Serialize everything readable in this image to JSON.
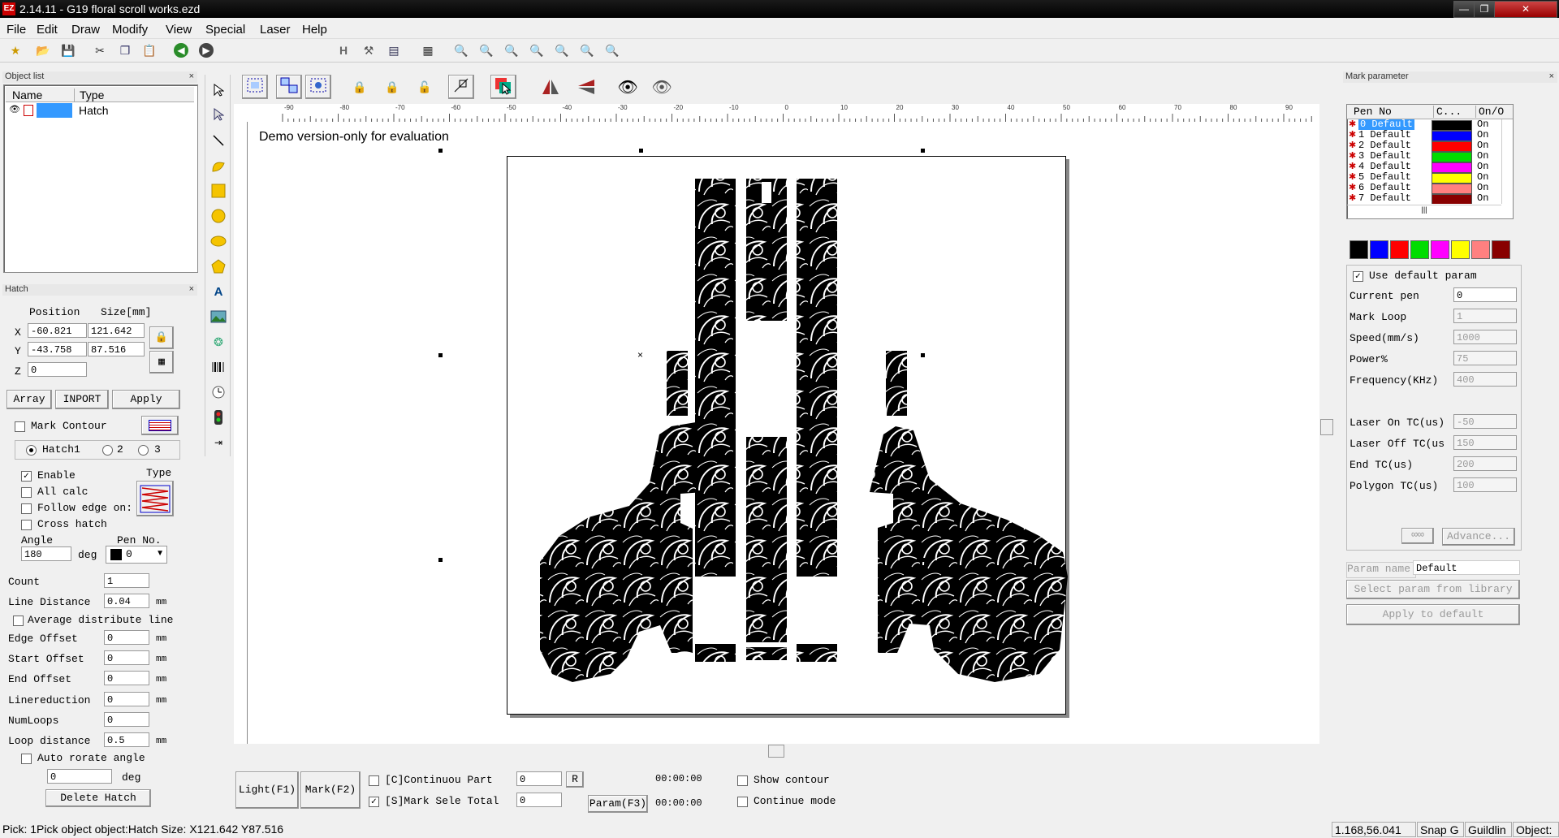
{
  "window": {
    "title": "2.14.11 - G19 floral scroll works.ezd",
    "app_icon": "EZ"
  },
  "menu": [
    "File",
    "Edit",
    "Draw",
    "Modify",
    "View",
    "Special",
    "Laser",
    "Help"
  ],
  "object_list": {
    "header": "Object list",
    "columns": [
      "Name",
      "Type"
    ],
    "rows": [
      {
        "name": "",
        "type": "Hatch"
      }
    ]
  },
  "hatch_panel": {
    "header": "Hatch",
    "position_label": "Position",
    "size_label": "Size[mm]",
    "x_label": "X",
    "y_label": "Y",
    "z_label": "Z",
    "pos_x": "-60.821",
    "pos_y": "-43.758",
    "pos_z": "0",
    "size_x": "121.642",
    "size_y": "87.516",
    "array_btn": "Array",
    "inport_btn": "INPORT",
    "apply_btn": "Apply",
    "mark_contour": "Mark Contour",
    "hatch1": "Hatch1",
    "hatch2": "2",
    "hatch3": "3",
    "enable": "Enable",
    "type_label": "Type",
    "all_calc": "All calc",
    "follow_edge": "Follow edge on:",
    "cross_hatch": "Cross hatch",
    "angle_label": "Angle",
    "angle_value": "180",
    "deg1": "deg",
    "pen_no_label": "Pen No.",
    "pen_no_value": "0",
    "count_label": "Count",
    "count_value": "1",
    "line_distance_label": "Line Distance",
    "line_distance_value": "0.04",
    "avg_distribute": "Average distribute line",
    "edge_offset_label": "Edge Offset",
    "edge_offset_value": "0",
    "start_offset_label": "Start Offset",
    "start_offset_value": "0",
    "end_offset_label": "End Offset",
    "end_offset_value": "0",
    "linereduction_label": "Linereduction",
    "linereduction_value": "0",
    "numloops_label": "NumLoops",
    "numloops_value": "0",
    "loop_distance_label": "Loop distance",
    "loop_distance_value": "0.5",
    "mm": "mm",
    "auto_rotate": "Auto rorate angle",
    "auto_rotate_value": "0",
    "deg2": "deg",
    "delete_hatch": "Delete Hatch"
  },
  "canvas": {
    "demo_text": "Demo version-only for evaluation",
    "ruler_labels": [
      "-90",
      "-80",
      "-70",
      "-60",
      "-50",
      "-40",
      "-30",
      "-20",
      "-10",
      "0",
      "10",
      "20",
      "30",
      "40",
      "50",
      "60",
      "70",
      "80",
      "90"
    ]
  },
  "bottom_bar": {
    "light_btn": "Light(F1)",
    "mark_btn": "Mark(F2)",
    "continuous_part": "[C]Continuou Part",
    "part_value": "0",
    "r_btn": "R",
    "mark_sele": "[S]Mark Sele Total",
    "total_value": "0",
    "param_btn": "Param(F3)",
    "time1": "00:00:00",
    "time2": "00:00:00",
    "show_contour": "Show contour",
    "continue_mode": "Continue mode"
  },
  "mark_parameter": {
    "header": "Mark parameter",
    "columns": [
      "Pen No",
      "C...",
      "On/O"
    ],
    "pens": [
      {
        "no": "0 Default",
        "color": "#000000",
        "on": "On"
      },
      {
        "no": "1 Default",
        "color": "#0000ff",
        "on": "On"
      },
      {
        "no": "2 Default",
        "color": "#ff0000",
        "on": "On"
      },
      {
        "no": "3 Default",
        "color": "#00dd00",
        "on": "On"
      },
      {
        "no": "4 Default",
        "color": "#ff00ff",
        "on": "On"
      },
      {
        "no": "5 Default",
        "color": "#ffff00",
        "on": "On"
      },
      {
        "no": "6 Default",
        "color": "#ff8080",
        "on": "On"
      },
      {
        "no": "7 Default",
        "color": "#880000",
        "on": "On"
      }
    ],
    "swatches": [
      "#000000",
      "#0000ff",
      "#ff0000",
      "#00dd00",
      "#ff00ff",
      "#ffff00",
      "#ff8080",
      "#880000"
    ],
    "use_default": "Use default param",
    "current_pen_label": "Current pen",
    "current_pen_value": "0",
    "mark_loop_label": "Mark Loop",
    "mark_loop_value": "1",
    "speed_label": "Speed(mm/s)",
    "speed_value": "1000",
    "power_label": "Power%",
    "power_value": "75",
    "frequency_label": "Frequency(KHz)",
    "frequency_value": "400",
    "laser_on_label": "Laser On TC(us)",
    "laser_on_value": "-50",
    "laser_off_label": "Laser Off TC(us",
    "laser_off_value": "150",
    "end_tc_label": "End TC(us)",
    "end_tc_value": "200",
    "polygon_tc_label": "Polygon TC(us)",
    "polygon_tc_value": "100",
    "advance_btn": "Advance...",
    "param_name_label": "Param name",
    "param_name_value": "Default",
    "select_param_btn": "Select param from library",
    "apply_default_btn": "Apply to default"
  },
  "status_bar": {
    "message": "Pick: 1Pick object object:Hatch Size: X121.642 Y87.516",
    "coords": "1.168,56.041",
    "snap": "Snap G",
    "guideline": "Guildlin",
    "object": "Object:"
  }
}
